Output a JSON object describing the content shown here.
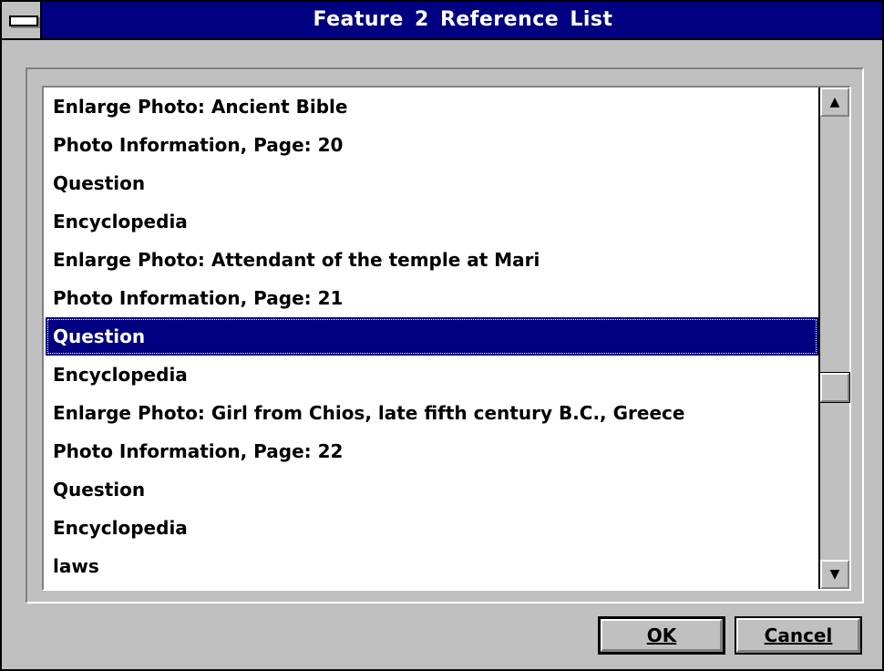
{
  "window": {
    "title": "Feature 2 Reference List"
  },
  "list": {
    "items": [
      "Enlarge Photo: Ancient Bible",
      "Photo Information, Page: 20",
      "Question",
      "Encyclopedia",
      "Enlarge Photo: Attendant of the temple at Mari",
      "Photo Information, Page: 21",
      "Question",
      "Encyclopedia",
      "Enlarge Photo: Girl from Chios, late fifth century B.C., Greece",
      "Photo Information, Page: 22",
      "Question",
      "Encyclopedia",
      "laws"
    ],
    "selected_index": 6,
    "scroll_position": 0.62
  },
  "scrollbar": {
    "up_icon": "arrow-up-icon",
    "down_icon": "arrow-down-icon"
  },
  "buttons": {
    "ok_label": "OK",
    "cancel_label": "Cancel"
  },
  "colors": {
    "titlebar": "#000080",
    "selection": "#000080",
    "face": "#c0c0c0"
  }
}
